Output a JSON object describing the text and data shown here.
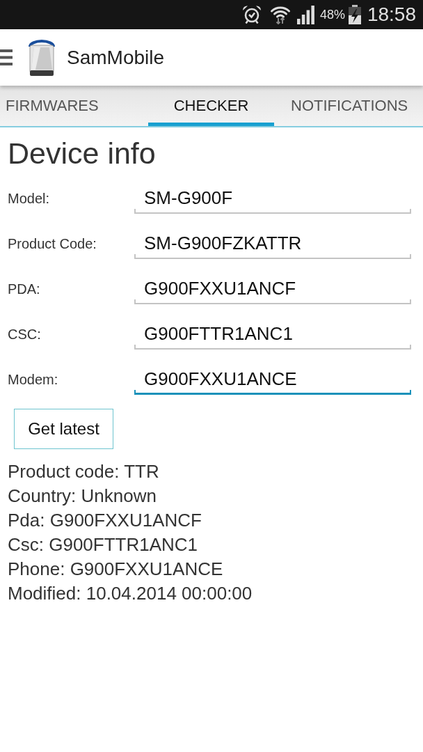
{
  "status_bar": {
    "battery": "48%",
    "time": "18:58"
  },
  "app_bar": {
    "title": "SamMobile"
  },
  "tabs": [
    {
      "label": "FIRMWARES",
      "selected": false
    },
    {
      "label": "CHECKER",
      "selected": true
    },
    {
      "label": "NOTIFICATIONS",
      "selected": false
    }
  ],
  "form": {
    "title": "Device info",
    "fields": [
      {
        "label": "Model:",
        "value": "SM-G900F",
        "focused": false
      },
      {
        "label": "Product Code:",
        "value": "SM-G900FZKATTR",
        "focused": false
      },
      {
        "label": "PDA:",
        "value": "G900FXXU1ANCF",
        "focused": false
      },
      {
        "label": "CSC:",
        "value": "G900FTTR1ANC1",
        "focused": false
      },
      {
        "label": "Modem:",
        "value": "G900FXXU1ANCE",
        "focused": true
      }
    ],
    "button": "Get latest"
  },
  "results": [
    "Product code: TTR",
    "Country: Unknown",
    "Pda: G900FXXU1ANCF",
    "Csc: G900FTTR1ANC1",
    "Phone: G900FXXU1ANCE",
    "Modified: 10.04.2014 00:00:00"
  ]
}
